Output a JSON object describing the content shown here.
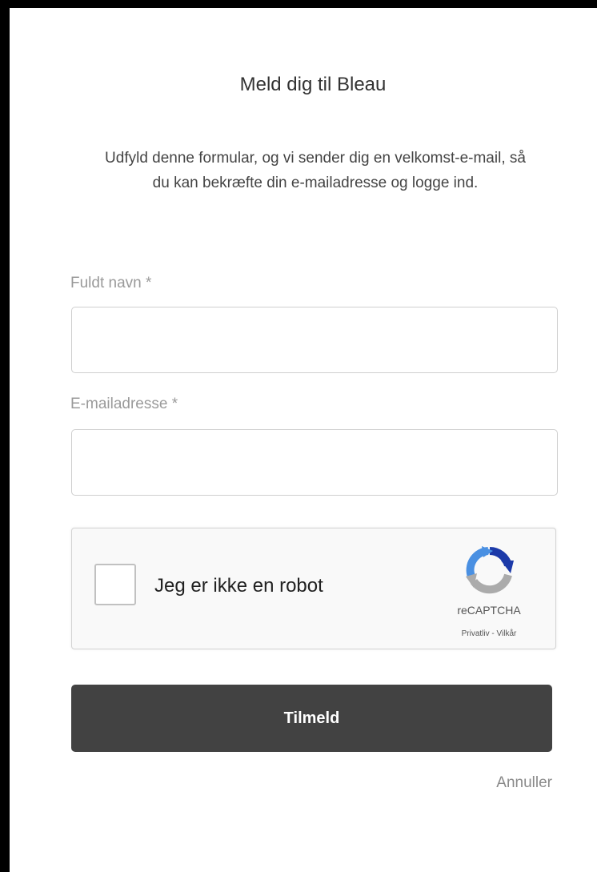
{
  "form": {
    "title": "Meld dig til Bleau",
    "intro": "Udfyld denne formular, og vi sender dig en velkomst-e-mail, så du kan bekræfte din e-mailadresse og logge ind.",
    "full_name": {
      "label": "Fuldt navn *",
      "value": "",
      "placeholder": ""
    },
    "email": {
      "label": "E-mailadresse *",
      "value": "",
      "placeholder": ""
    },
    "recaptcha": {
      "label": "Jeg er ikke en robot",
      "brand": "reCAPTCHA",
      "privacy_link": "Privatliv",
      "separator": " - ",
      "terms_link": "Vilkår",
      "checked": false
    },
    "submit_label": "Tilmeld",
    "cancel_label": "Annuller"
  },
  "colors": {
    "button_bg": "#424242",
    "button_text": "#ffffff",
    "label_gray": "#9a9a9a",
    "recaptcha_blue": "#1c3aa9",
    "recaptcha_light_blue": "#4a90e2",
    "recaptcha_gray": "#ababab"
  }
}
